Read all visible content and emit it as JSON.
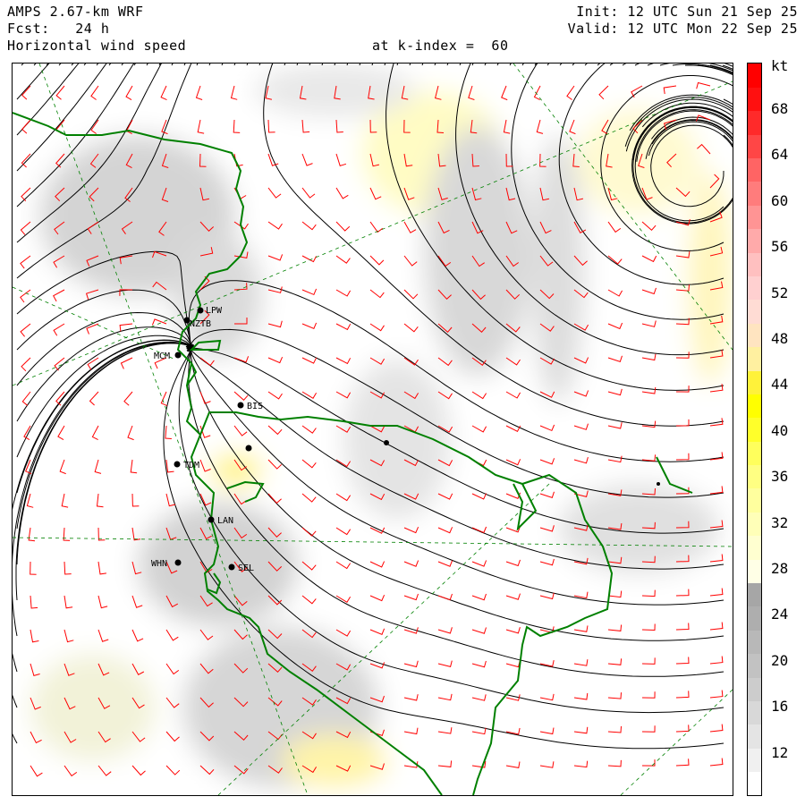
{
  "header": {
    "line1_left": "AMPS 2.67-km WRF",
    "line2_left": "Fcst:   24 h",
    "line3_left": "Horizontal wind speed",
    "level": "at k-index =  60",
    "init": "Init: 12 UTC Sun 21 Sep 25",
    "valid": "Valid: 12 UTC Mon 22 Sep 25"
  },
  "colorbar": {
    "unit": "kt",
    "labels": [
      "68",
      "64",
      "60",
      "56",
      "52",
      "48",
      "44",
      "40",
      "36",
      "32",
      "28",
      "24",
      "20",
      "16",
      "12"
    ],
    "colors": [
      "#ffffff",
      "#f0f0f0",
      "#e4e4e4",
      "#d8d8d8",
      "#cccccc",
      "#c2c2c2",
      "#b8b8b8",
      "#aeaeae",
      "#a6a6a6",
      "#ffffe6",
      "#ffffd0",
      "#ffffb8",
      "#ffff9e",
      "#ffff82",
      "#ffff5c",
      "#ffff2a",
      "#ffff00",
      "#fff23a",
      "#fff0a0",
      "#ffe4c0",
      "#ffdcd4",
      "#ffd0d0",
      "#ffc0c0",
      "#ffaaaa",
      "#ff9494",
      "#ff7c7c",
      "#ff6464",
      "#ff4646",
      "#ff2a2a",
      "#ff1010",
      "#ff0000"
    ]
  },
  "stations": [
    {
      "id": "LPW"
    },
    {
      "id": "NZTB"
    },
    {
      "id": "MCM"
    },
    {
      "id": "BIS"
    },
    {
      "id": "TDM"
    },
    {
      "id": "LAN"
    },
    {
      "id": "WHN"
    },
    {
      "id": "SEL"
    }
  ],
  "map": {
    "colors": {
      "coastline": "#008000",
      "barbs": "#ff0000",
      "streamlines": "#000000",
      "graticule": "#008000"
    }
  }
}
